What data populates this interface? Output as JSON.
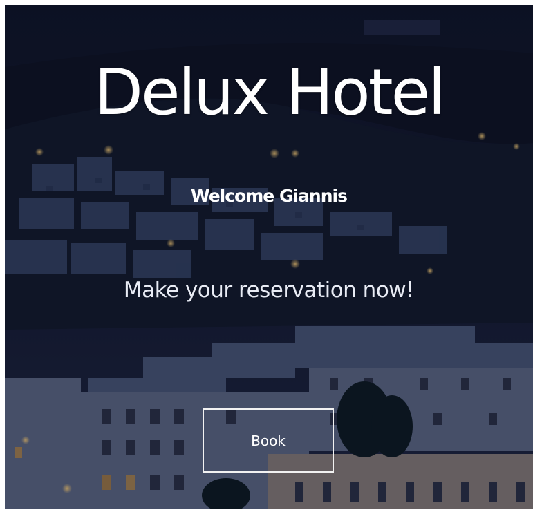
{
  "hero": {
    "title": "Delux Hotel",
    "welcome": "Welcome Giannis",
    "cta": "Make your reservation now!",
    "book_label": "Book"
  },
  "colors": {
    "night_sky": "#0b1226",
    "text": "#ffffff",
    "button_border": "#f2f2f2"
  }
}
